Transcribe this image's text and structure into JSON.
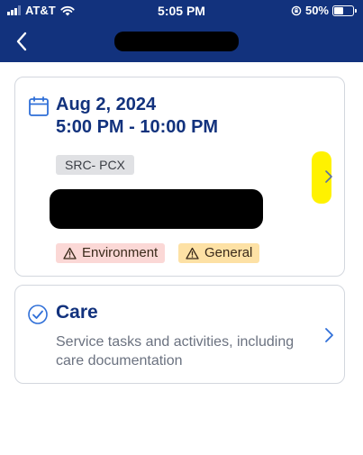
{
  "status_bar": {
    "carrier": "AT&T",
    "time": "5:05 PM",
    "battery": "50%",
    "battery_level": 0.5
  },
  "header": {
    "back_icon": "chevron-left-icon"
  },
  "shift_card": {
    "date": "Aug 2, 2024",
    "time_range": "5:00 PM - 10:00 PM",
    "code": "SRC- PCX",
    "tags": [
      {
        "label": "Environment",
        "icon": "warning-icon",
        "color": "#fbd8d6"
      },
      {
        "label": "General",
        "icon": "warning-icon",
        "color": "#fde1a5"
      }
    ]
  },
  "care_card": {
    "title": "Care",
    "description": "Service tasks and activities, including care documentation",
    "icon": "check-circle-icon"
  },
  "colors": {
    "header_bg": "#12327d",
    "accent": "#2f6fd8",
    "highlight": "#fff200"
  }
}
